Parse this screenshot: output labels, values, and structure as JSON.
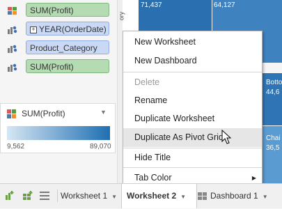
{
  "marks": {
    "rows": [
      {
        "label": "SUM(Profit)",
        "kind": "green",
        "icon": "color-icon"
      },
      {
        "label": "YEAR(OrderDate)",
        "kind": "blue",
        "icon": "detail-icon",
        "expandable": true
      },
      {
        "label": "Product_Category",
        "kind": "blue",
        "icon": "detail-icon"
      },
      {
        "label": "SUM(Profit)",
        "kind": "green",
        "icon": "detail-icon"
      }
    ]
  },
  "legend": {
    "title": "SUM(Profit)",
    "min": "9,562",
    "max": "89,070",
    "gradient_start": "#d6e6f3",
    "gradient_end": "#1f6fb2"
  },
  "treemap": {
    "tiles": [
      {
        "value": "71,437",
        "color": "#2a6fb0"
      },
      {
        "value": "64,127",
        "color": "#3f82c0"
      },
      {
        "value": "Botto",
        "color": "#2f74b4"
      },
      {
        "value": "44,6",
        "color": "#2f74b4"
      },
      {
        "value": "Chai",
        "color": "#5a9bd1"
      },
      {
        "value": "36,5",
        "color": "#5a9bd1"
      }
    ]
  },
  "context_menu": {
    "items": [
      {
        "label": "New Worksheet",
        "enabled": true
      },
      {
        "label": "New Dashboard",
        "enabled": true
      },
      {
        "label": "Delete",
        "enabled": false
      },
      {
        "label": "Rename",
        "enabled": true
      },
      {
        "label": "Duplicate Worksheet",
        "enabled": true
      },
      {
        "label": "Duplicate As Pivot Grid",
        "enabled": true,
        "hover": true
      },
      {
        "label": "Hide Title",
        "enabled": true
      },
      {
        "label": "Tab Color",
        "enabled": true,
        "submenu": true
      }
    ]
  },
  "tabs": [
    {
      "label": "Worksheet 1",
      "active": false
    },
    {
      "label": "Worksheet 2",
      "active": true
    },
    {
      "label": "Dashboard 1",
      "active": false
    }
  ]
}
